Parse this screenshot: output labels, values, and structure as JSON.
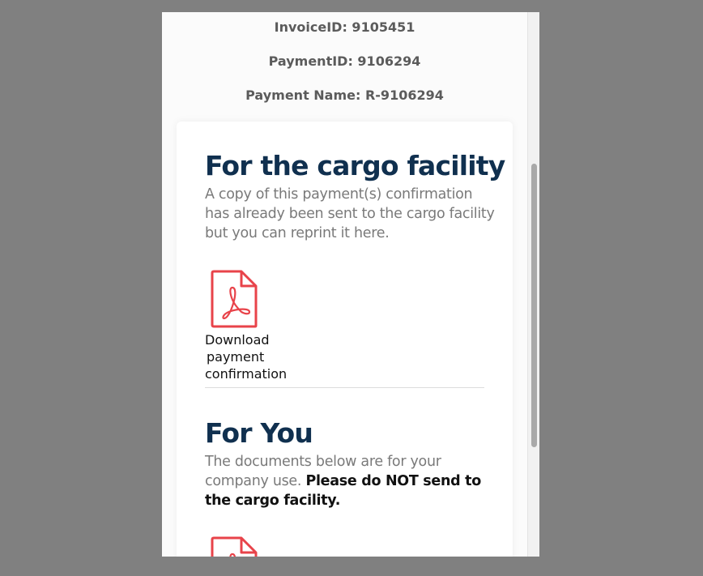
{
  "meta": {
    "invoice_id": "InvoiceID: 9105451",
    "payment_id": "PaymentID: 9106294",
    "payment_name": "Payment Name: R-9106294"
  },
  "cargo_section": {
    "title": "For the cargo facility",
    "description": "A copy of this payment(s) confirmation has already been sent to the cargo facility but you can reprint it here.",
    "download_label_line1": "Download",
    "download_label_line2": "payment",
    "download_label_line3": "confirmation",
    "icon": "pdf-icon",
    "icon_color": "#e8434a"
  },
  "you_section": {
    "title": "For You",
    "description_plain": "The documents below are for your company use.",
    "description_bold": "Please do NOT send to the cargo facility.",
    "icon": "pdf-icon"
  },
  "colors": {
    "overlay": "#808080",
    "heading": "#10304f",
    "meta_text": "#5b5b5b"
  }
}
